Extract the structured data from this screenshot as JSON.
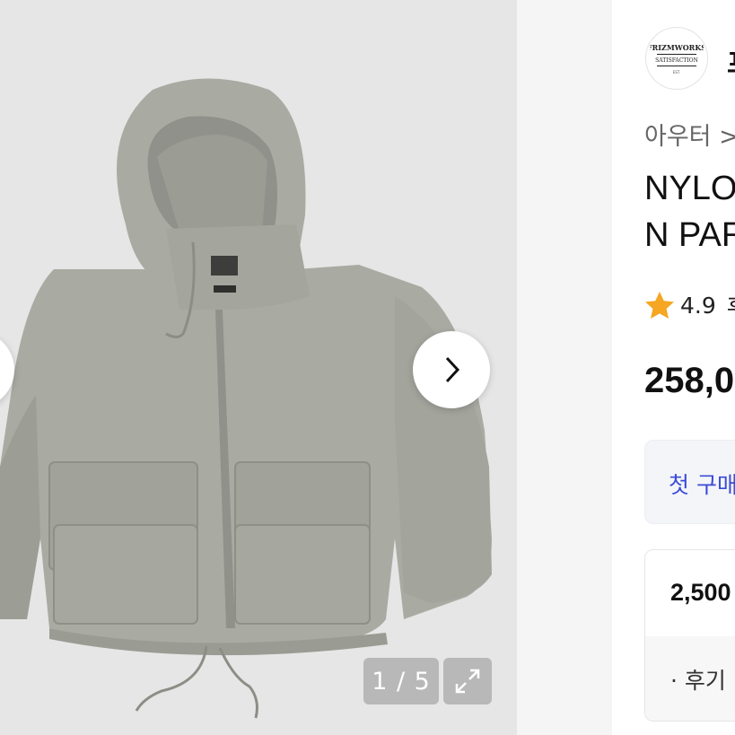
{
  "gallery": {
    "counter": "1 / 5",
    "current_image": 1,
    "total_images": 5,
    "prev_icon": "chevron-left-icon",
    "next_icon": "chevron-right-icon",
    "expand_icon": "expand-icon"
  },
  "brand": {
    "logo_text_top": "FRIZMWORKS",
    "logo_text_bottom": "SATISFACTION",
    "name_partial": "프"
  },
  "product": {
    "breadcrumb": "아우터 >",
    "title_line1": "NYLO",
    "title_line2": "N PAR",
    "rating_value": "4.9",
    "rating_more": "후",
    "price": "258,0"
  },
  "coupon": {
    "text": "첫 구매"
  },
  "points": {
    "amount": "2,500",
    "sub_text": "· 후기"
  },
  "colors": {
    "star": "#f5a623",
    "coupon_text": "#3a4bd8",
    "jacket": "#a9aba3"
  }
}
